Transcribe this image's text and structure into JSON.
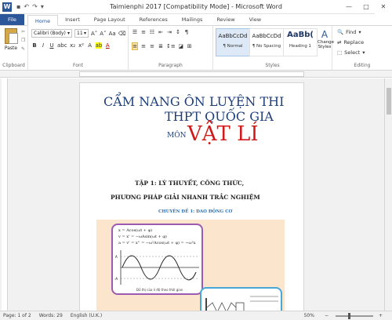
{
  "window": {
    "title": "Taimienphi 2017 [Compatibility Mode] - Microsoft Word"
  },
  "titlebar": {
    "qat": [
      "save-icon",
      "undo-icon",
      "redo-icon",
      "customize-icon"
    ]
  },
  "tabs": [
    {
      "label": "File"
    },
    {
      "label": "Home"
    },
    {
      "label": "Insert"
    },
    {
      "label": "Page Layout"
    },
    {
      "label": "References"
    },
    {
      "label": "Mailings"
    },
    {
      "label": "Review"
    },
    {
      "label": "View"
    }
  ],
  "ribbon": {
    "clipboard": {
      "label": "Clipboard",
      "paste": "Paste"
    },
    "font": {
      "label": "Font",
      "font_name": "Calibri (Body)",
      "font_size": "11"
    },
    "paragraph": {
      "label": "Paragraph"
    },
    "styles": {
      "label": "Styles",
      "items": [
        {
          "sample": "AaBbCcDd",
          "name": "¶ Normal"
        },
        {
          "sample": "AaBbCcDd",
          "name": "¶ No Spacing"
        },
        {
          "sample": "AaBb(",
          "name": "Heading 1"
        }
      ],
      "change_styles": "Change Styles"
    },
    "editing": {
      "label": "Editing",
      "find": "Find",
      "replace": "Replace",
      "select": "Select"
    }
  },
  "document": {
    "title_line1": "CẨM NANG ÔN LUYỆN THI",
    "title_line2": "THPT QUỐC GIA",
    "subject_prefix": "MÔN",
    "subject": "VẬT LÍ",
    "heading1": "TẬP 1: LÝ THUYẾT, CÔNG THỨC,",
    "heading2": "PHƯƠNG PHÁP GIẢI NHANH TRẮC NGHIỆM",
    "chapter": "CHUYÊN ĐỀ 1: DAO ĐỘNG CƠ",
    "formulas": [
      "x = Acos(ωt + φ)",
      "v = x' = −ωAsin(ωt + φ)",
      "a = v' = x'' = −ω²Acos(ωt + φ) = −ω²x"
    ],
    "graph_caption": "Đồ thị của li độ theo thời gian"
  },
  "status": {
    "page": "Page: 1 of 2",
    "words": "Words: 29",
    "language": "English (U.K.)",
    "zoom": "50%"
  }
}
